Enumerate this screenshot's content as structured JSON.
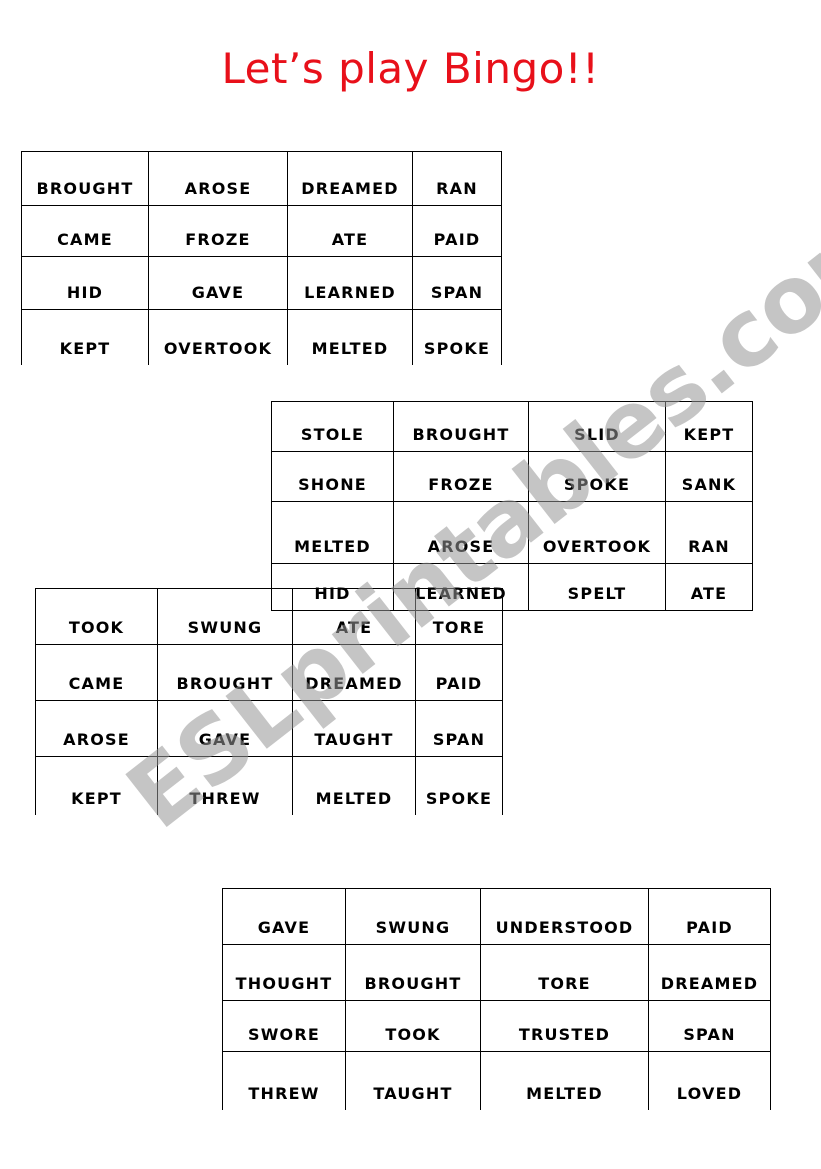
{
  "title": "Let’s play Bingo!!",
  "watermark": "ESLprintables.com",
  "cards": [
    {
      "rows": [
        [
          "BROUGHT",
          "AROSE",
          "DREAMED",
          "RAN"
        ],
        [
          "CAME",
          "FROZE",
          "ATE",
          "PAID"
        ],
        [
          "HID",
          "GAVE",
          "LEARNED",
          "SPAN"
        ],
        [
          "KEPT",
          "OVERTOOK",
          "MELTED",
          "SPOKE"
        ]
      ]
    },
    {
      "rows": [
        [
          "STOLE",
          "BROUGHT",
          "SLID",
          "KEPT"
        ],
        [
          "SHONE",
          "FROZE",
          "SPOKE",
          "SANK"
        ],
        [
          "MELTED",
          "AROSE",
          "OVERTOOK",
          "RAN"
        ],
        [
          "HID",
          "LEARNED",
          "SPELT",
          "ATE"
        ]
      ]
    },
    {
      "rows": [
        [
          "TOOK",
          "SWUNG",
          "ATE",
          "TORE"
        ],
        [
          "CAME",
          "BROUGHT",
          "DREAMED",
          "PAID"
        ],
        [
          "AROSE",
          "GAVE",
          "TAUGHT",
          "SPAN"
        ],
        [
          "KEPT",
          "THREW",
          "MELTED",
          "SPOKE"
        ]
      ]
    },
    {
      "rows": [
        [
          "GAVE",
          "SWUNG",
          "UNDERSTOOD",
          "PAID"
        ],
        [
          "THOUGHT",
          "BROUGHT",
          "TORE",
          "DREAMED"
        ],
        [
          "SWORE",
          "TOOK",
          "TRUSTED",
          "SPAN"
        ],
        [
          "THREW",
          "TAUGHT",
          "MELTED",
          "LOVED"
        ]
      ]
    }
  ]
}
